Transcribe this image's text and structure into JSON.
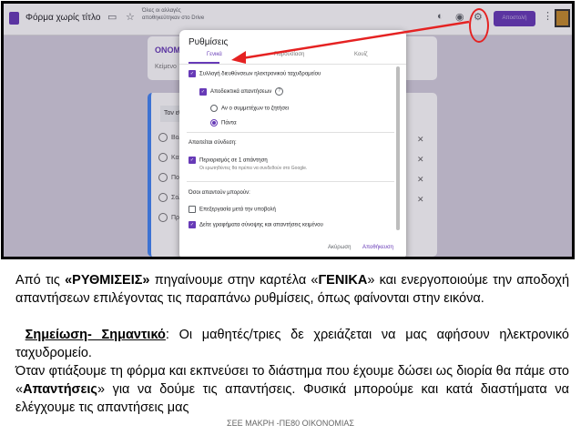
{
  "app": {
    "form_title": "Φόρμα χωρίς τίτλο",
    "save_status": "Όλες οι αλλαγές αποθηκεύτηκαν στο Drive",
    "send_label": "Αποστολή",
    "icons": [
      "palette-icon",
      "eye-icon",
      "gear-icon",
      "more-icon"
    ]
  },
  "background": {
    "card_title": "ΟΝΟΜΑ",
    "card_desc": "Κείμενο",
    "question_tab": "Τον εθ",
    "rows": [
      "Βολ",
      "Καρ",
      "Πολ",
      "Σολ",
      "Προ"
    ]
  },
  "dialog": {
    "title": "Ρυθμίσεις",
    "tabs": [
      "Γενικά",
      "Παρουσίαση",
      "Κουίζ"
    ],
    "collect_emails": "Συλλογή διευθύνσεων ηλεκτρονικού ταχυδρομείου",
    "response_receipts": "Αποδεικτικά απαντήσεων",
    "if_asked": "Αν ο συμμετέχων το ζητήσει",
    "always": "Πάντα",
    "requires_signin": "Απαιτείται σύνδεση:",
    "limit_one": "Περιορισμός σε 1 απάντηση",
    "limit_one_sub": "Οι ερωτηθέντες θα πρέπει να συνδεθούν στο Google.",
    "respondents_can": "Όσοι απαντούν μπορούν:",
    "edit_after": "Επεξεργασία μετά την υποβολή",
    "see_summary": "Δείτε γραφήματα σύνοψης και απαντήσεις κειμένου",
    "cancel": "Ακύρωση",
    "save": "Αποθήκευση"
  },
  "caption": {
    "p1_a": "Από τις ",
    "p1_b": "«ΡΥΘΜΙΣΕΙΣ»",
    "p1_c": " πηγαίνουμε στην καρτέλα «",
    "p1_d": "ΓΕΝΙΚΑ",
    "p1_e": "» και ενεργοποιούμε την αποδοχή απαντήσεων επιλέγοντας τις παραπάνω ρυθμίσεις, όπως φαίνονται στην εικόνα.",
    "p2_a": "Σημείωση- Σημαντικό",
    "p2_b": ": Οι μαθητές/τριες δε χρειάζεται να μας αφήσουν ηλεκτρονικό ταχυδρομείο.",
    "p3_a": "Όταν φτιάξουμε τη φόρμα και εκπνεύσει το διάστημα που έχουμε δώσει ως διορία θα πάμε στο «",
    "p3_b": "Απαντήσεις",
    "p3_c": "» για να δούμε τις απαντήσεις. Φυσικά μπορούμε και κατά διαστήματα να ελέγχουμε τις απαντήσεις μας"
  },
  "footer": "ΣΕΕ ΜΑΚΡΗ -ΠΕ80 ΟΙΚΟΝΟΜΙΑΣ",
  "colors": {
    "accent": "#673ab7",
    "annotation": "#e52222"
  }
}
